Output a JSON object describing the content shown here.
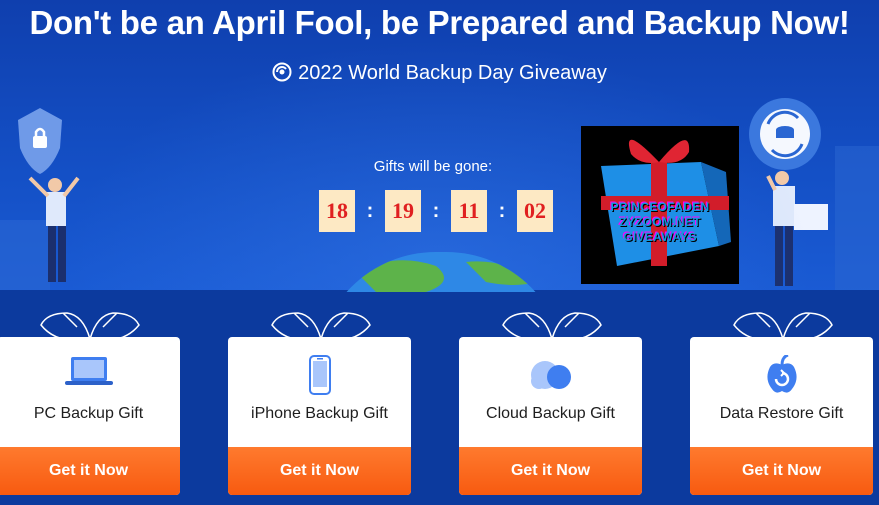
{
  "headline": "Don't be an April Fool, be Prepared and Backup Now!",
  "subheadline": "2022 World Backup Day Giveaway",
  "countdown": {
    "label": "Gifts will be gone:",
    "hours": "18",
    "minutes": "19",
    "seconds": "11",
    "centis": "02"
  },
  "promo_image": {
    "lines": [
      "PRINCEOFADEN",
      "ZYZOOM.NET",
      "GIVEAWAYS"
    ]
  },
  "gifts": [
    {
      "label": "PC Backup Gift",
      "button": "Get it Now",
      "icon": "laptop-icon"
    },
    {
      "label": "iPhone Backup Gift",
      "button": "Get it Now",
      "icon": "iphone-icon"
    },
    {
      "label": "Cloud Backup Gift",
      "button": "Get it Now",
      "icon": "cloud-icon"
    },
    {
      "label": "Data Restore Gift",
      "button": "Get it Now",
      "icon": "apple-restore-icon"
    }
  ],
  "colors": {
    "accent": "#f75a10",
    "background": "#1450c6",
    "timer_bg": "#fde9c4",
    "timer_text": "#e02020"
  }
}
